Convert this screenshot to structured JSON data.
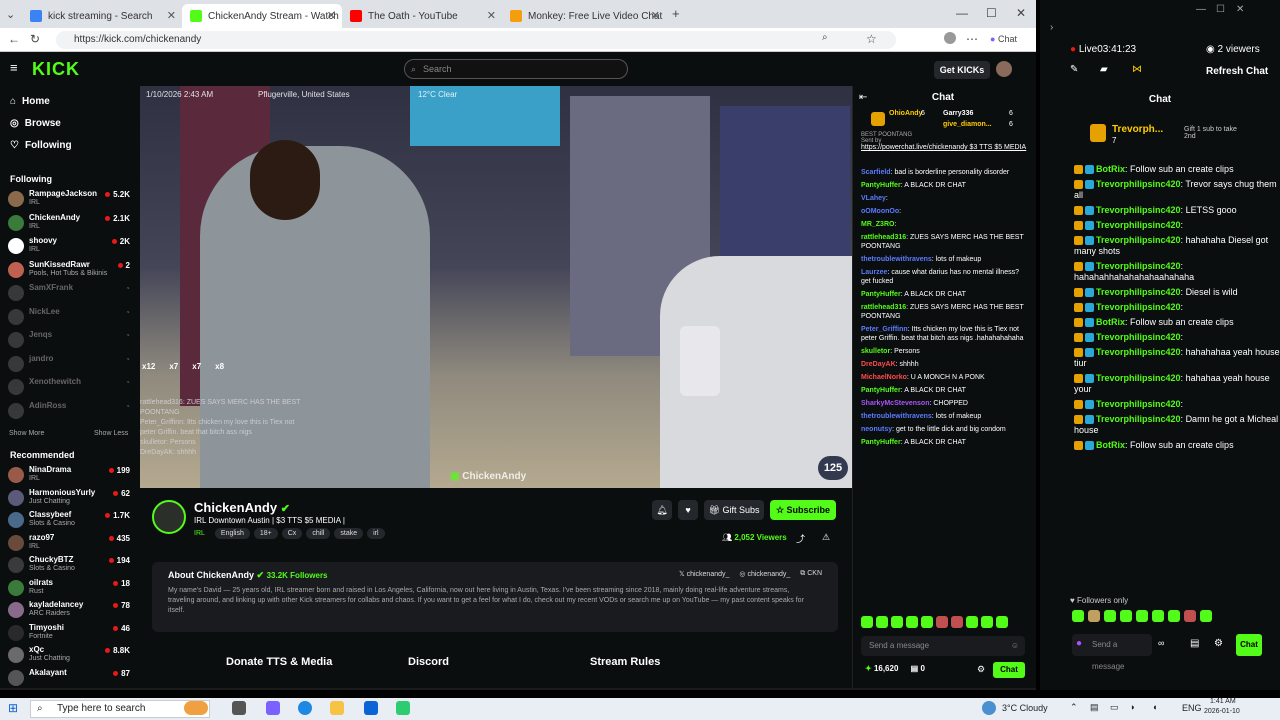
{
  "browser": {
    "tabs": [
      {
        "label": "kick streaming - Search",
        "color": "#3b82f6"
      },
      {
        "label": "ChickenAndy Stream - Watch Live",
        "color": "#53fc18"
      },
      {
        "label": "The Oath - YouTube",
        "color": "#ff0000"
      },
      {
        "label": "Monkey: Free Live Video Chat",
        "color": "#f59e0b"
      }
    ],
    "url": "https://kick.com/chickenandy",
    "chat_button": "Chat"
  },
  "kick": {
    "logo": "KICK",
    "search_placeholder": "Search",
    "get_kicks": "Get KICKs",
    "nav": [
      {
        "label": "Home",
        "icon": "home-icon"
      },
      {
        "label": "Browse",
        "icon": "compass-icon"
      },
      {
        "label": "Following",
        "icon": "heart-icon"
      }
    ],
    "following_title": "Following",
    "following": [
      {
        "name": "RampageJackson",
        "cat": "IRL",
        "viewers": "5.2K",
        "live": true,
        "color": "#8a6a4a"
      },
      {
        "name": "ChickenAndy",
        "cat": "IRL",
        "viewers": "2.1K",
        "live": true,
        "color": "#3a7a3a"
      },
      {
        "name": "shoovy",
        "cat": "IRL",
        "viewers": "2K",
        "live": true,
        "color": "#ffffff"
      },
      {
        "name": "SunKissedRawr",
        "cat": "Pools, Hot Tubs & Bikinis",
        "viewers": "2",
        "live": true,
        "color": "#c06050"
      },
      {
        "name": "SamXFrank",
        "cat": "",
        "viewers": "",
        "live": false,
        "color": "#777"
      },
      {
        "name": "NickLee",
        "cat": "",
        "viewers": "",
        "live": false,
        "color": "#777"
      },
      {
        "name": "Jenqs",
        "cat": "",
        "viewers": "",
        "live": false,
        "color": "#777"
      },
      {
        "name": "jandro",
        "cat": "",
        "viewers": "",
        "live": false,
        "color": "#777"
      },
      {
        "name": "Xenothewitch",
        "cat": "",
        "viewers": "",
        "live": false,
        "color": "#777"
      },
      {
        "name": "AdinRoss",
        "cat": "",
        "viewers": "",
        "live": false,
        "color": "#777"
      }
    ],
    "show_more": "Show More",
    "show_less": "Show Less",
    "recommended_title": "Recommended",
    "recommended": [
      {
        "name": "NinaDrama",
        "cat": "IRL",
        "viewers": "199",
        "color": "#9a5a4a"
      },
      {
        "name": "HarmoniousYurly",
        "cat": "Just Chatting",
        "viewers": "62",
        "color": "#5a5a7a"
      },
      {
        "name": "Classybeef",
        "cat": "Slots & Casino",
        "viewers": "1.7K",
        "color": "#4a6a8a"
      },
      {
        "name": "razo97",
        "cat": "IRL",
        "viewers": "435",
        "color": "#6a4a3a"
      },
      {
        "name": "ChuckyBTZ",
        "cat": "Slots & Casino",
        "viewers": "194",
        "color": "#3a3a3a"
      },
      {
        "name": "oilrats",
        "cat": "Rust",
        "viewers": "18",
        "color": "#3a7a3a"
      },
      {
        "name": "kayladelancey",
        "cat": "ARC Raiders",
        "viewers": "78",
        "color": "#8a6a8a"
      },
      {
        "name": "Timyoshi",
        "cat": "Fortnite",
        "viewers": "46",
        "color": "#2a2a2a"
      },
      {
        "name": "xQc",
        "cat": "Just Chatting",
        "viewers": "8.8K",
        "color": "#6a6a6a"
      },
      {
        "name": "Akalayant",
        "cat": "",
        "viewers": "87",
        "color": "#555"
      }
    ],
    "video": {
      "timestamp": "1/10/2026 2:43 AM",
      "location": "Pflugerville, United States",
      "weather": "12°C Clear",
      "viewer_count_badge": "125",
      "watermark": "ChickenAndy",
      "counts": [
        "x12",
        "x7",
        "x7",
        "x8"
      ],
      "overlay_chat": [
        "rattlehead316: ZUES SAYS MERC HAS THE BEST POONTANG",
        "Peter_Griffinn: Itts chicken my love this is Tiex not peter Griffin. beat that bitch ass nigs",
        "skulletor: Persons",
        "DreDayAK: shhhh"
      ]
    },
    "stream": {
      "name": "ChickenAndy",
      "title": "IRL Downtown Austin | $3 TTS $5 MEDIA |",
      "category": "IRL",
      "tags": [
        "English",
        "18+",
        "Cx",
        "chill",
        "stake",
        "irl"
      ],
      "gift_subs": "Gift Subs",
      "subscribe": "Subscribe",
      "viewers": "2,052 Viewers"
    },
    "about": {
      "title": "About ChickenAndy",
      "followers": "33.2K Followers",
      "socials": [
        "chickenandy_",
        "chickenandy_",
        "CKN"
      ],
      "text": "My name's David — 25 years old, IRL streamer born and raised in Los Angeles, California, now out here living in Austin, Texas. I've been streaming since 2018, mainly doing real-life adventure streams, traveling around, and linking up with other Kick streamers for collabs and chaos. If you want to get a feel for what I do, check out my recent VODs or search me up on YouTube — my past content speaks for itself."
    },
    "panels": [
      "Donate TTS & Media",
      "Discord",
      "Stream Rules"
    ],
    "chat": {
      "title": "Chat",
      "top_gifters": [
        {
          "name": "OhioAndy",
          "count": "6"
        },
        {
          "name": "Garry336",
          "count": "6"
        },
        {
          "name": "give_diamon...",
          "count": "6"
        }
      ],
      "pinned_label": "BEST POONTANG",
      "pinned_sender": "Sent by",
      "pinned_text": "https://powerchat.live/chickenandy $3 TTS $5 MEDIA",
      "messages": [
        {
          "user": "Scarfield",
          "text": "bad is borderline personality disorder",
          "color": "#5b7bff"
        },
        {
          "user": "PantyHuffer",
          "text": "A BLACK DR CHAT",
          "color": "#53fc18"
        },
        {
          "user": "VLahey",
          "text": "",
          "color": "#5b7bff"
        },
        {
          "user": "oOMoonOo",
          "text": "",
          "color": "#5b7bff"
        },
        {
          "user": "MR_Z3RO",
          "text": "",
          "color": "#53fc18"
        },
        {
          "user": "rattlehead316",
          "text": "ZUES SAYS MERC HAS THE BEST POONTANG",
          "color": "#53fc18"
        },
        {
          "user": "thetroublewithravens",
          "text": "lots of makeup",
          "color": "#5b7bff"
        },
        {
          "user": "Laurzee",
          "text": "cause what darius has no mental illness? get fucked",
          "color": "#5b7bff"
        },
        {
          "user": "PantyHuffer",
          "text": "A BLACK DR CHAT",
          "color": "#53fc18"
        },
        {
          "user": "rattlehead316",
          "text": "ZUES SAYS MERC HAS THE BEST POONTANG",
          "color": "#53fc18"
        },
        {
          "user": "Peter_Griffinn",
          "text": "Itts chicken my love this is Tiex not peter Griffin. beat that bitch ass nigs .hahahahahaha",
          "color": "#5b7bff"
        },
        {
          "user": "skulletor",
          "text": "Persons",
          "color": "#53fc18"
        },
        {
          "user": "DreDayAK",
          "text": "shhhh",
          "color": "#ff4b4b"
        },
        {
          "user": "MichaelNorko",
          "text": "U A MONCH N A PONK",
          "color": "#ff4b4b"
        },
        {
          "user": "PantyHuffer",
          "text": "A BLACK DR CHAT",
          "color": "#53fc18"
        },
        {
          "user": "SharkyMcStevenson",
          "text": "CHOPPED",
          "color": "#a855f7"
        },
        {
          "user": "thetroublewithravens",
          "text": "lots of makeup",
          "color": "#5b7bff"
        },
        {
          "user": "neonutsy",
          "text": "get to the little dick and big condom",
          "color": "#5b7bff"
        },
        {
          "user": "PantyHuffer",
          "text": "A BLACK DR CHAT",
          "color": "#53fc18"
        }
      ],
      "input_placeholder": "Send a message",
      "points": "16,620",
      "gift_count": "0",
      "send": "Chat"
    }
  },
  "popout": {
    "live_label": "Live",
    "uptime": "03:41:23",
    "viewers": "2 viewers",
    "refresh": "Refresh Chat",
    "title": "Chat",
    "gifter": "Trevorph...",
    "gifter_count": "7",
    "gift_text": "Gift 1 sub to take 2nd",
    "messages": [
      {
        "user": "BotRix",
        "text": "Follow sub an create clips",
        "color": "#53fc18"
      },
      {
        "user": "Trevorphilipsinc420",
        "text": "Trevor says chug them all",
        "color": "#53fc18"
      },
      {
        "user": "Trevorphilipsinc420",
        "text": "LETSS gooo",
        "color": "#53fc18"
      },
      {
        "user": "Trevorphilipsinc420",
        "text": "",
        "color": "#53fc18"
      },
      {
        "user": "Trevorphilipsinc420",
        "text": "hahahaha Diesel got many shots",
        "color": "#53fc18"
      },
      {
        "user": "Trevorphilipsinc420",
        "text": "hahahahhahahahahaahahaha",
        "color": "#53fc18"
      },
      {
        "user": "Trevorphilipsinc420",
        "text": "Diesel is wild",
        "color": "#53fc18"
      },
      {
        "user": "Trevorphilipsinc420",
        "text": "",
        "color": "#53fc18"
      },
      {
        "user": "BotRix",
        "text": "Follow sub an create clips",
        "color": "#53fc18"
      },
      {
        "user": "Trevorphilipsinc420",
        "text": "",
        "color": "#53fc18"
      },
      {
        "user": "Trevorphilipsinc420",
        "text": "hahahahaa yeah house tiur",
        "color": "#53fc18"
      },
      {
        "user": "Trevorphilipsinc420",
        "text": "hahahaa yeah house your",
        "color": "#53fc18"
      },
      {
        "user": "Trevorphilipsinc420",
        "text": "",
        "color": "#53fc18"
      },
      {
        "user": "Trevorphilipsinc420",
        "text": "Damn he got a Micheal house",
        "color": "#53fc18"
      },
      {
        "user": "BotRix",
        "text": "Follow sub an create clips",
        "color": "#53fc18"
      }
    ],
    "followers_only": "Followers only",
    "input_placeholder": "Send a message",
    "send": "Chat"
  },
  "taskbar": {
    "search": "Type here to search",
    "weather": "3°C Cloudy",
    "lang": "ENG",
    "time": "1:41 AM",
    "date": "2026-01-10"
  }
}
